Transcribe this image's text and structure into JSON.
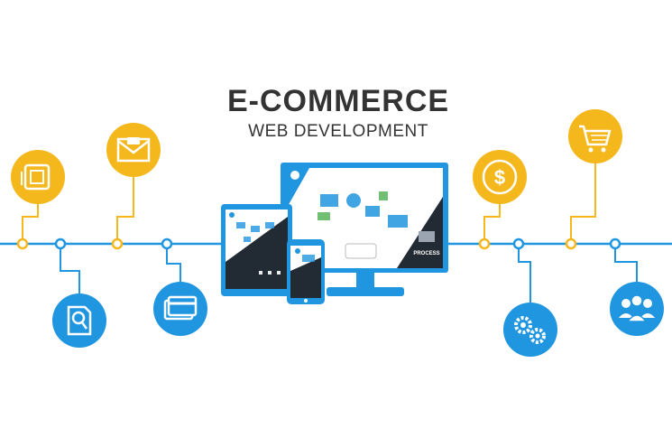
{
  "header": {
    "title": "E-COMMERCE",
    "subtitle": "WEB DEVELOPMENT"
  },
  "colors": {
    "accent_blue": "#2196e0",
    "accent_yellow": "#f5b81c",
    "text": "#333333"
  },
  "devices": {
    "monitor_label": "PROCESS"
  },
  "icons": [
    "calendar-icon",
    "envelope-icon",
    "dollar-icon",
    "shopping-cart-icon",
    "document-search-icon",
    "credit-card-icon",
    "gears-icon",
    "users-icon"
  ]
}
